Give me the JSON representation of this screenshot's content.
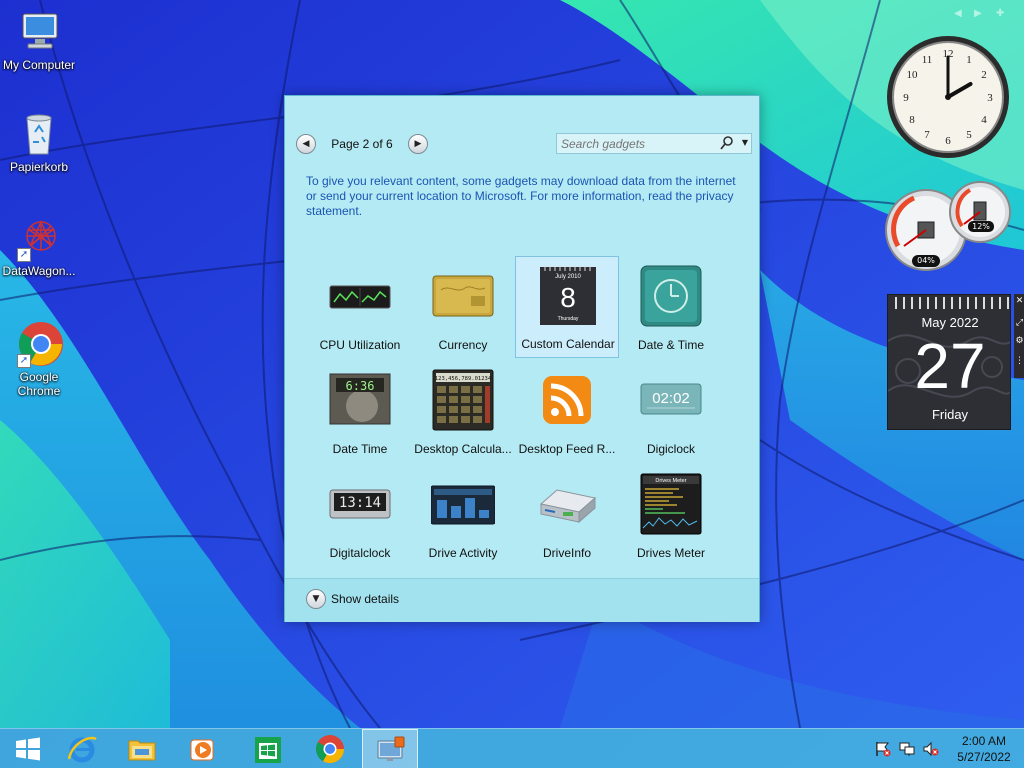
{
  "desktop": {
    "icons": [
      {
        "label": "My Computer"
      },
      {
        "label": "Papierkorb"
      },
      {
        "label": "DataWagon..."
      },
      {
        "label": "Google Chrome"
      }
    ]
  },
  "gallery": {
    "pager": {
      "label": "Page 2 of 6"
    },
    "search": {
      "placeholder": "Search gadgets"
    },
    "privacy_text": "To give you relevant content, some gadgets may download data from the internet or send your current location to Microsoft. For more information, read the privacy statement.",
    "gadgets": [
      {
        "label": "CPU Utilization",
        "selected": false
      },
      {
        "label": "Currency",
        "selected": false
      },
      {
        "label": "Custom Calendar",
        "selected": true
      },
      {
        "label": "Date & Time",
        "selected": false
      },
      {
        "label": "Date Time",
        "selected": false
      },
      {
        "label": "Desktop Calcula...",
        "selected": false
      },
      {
        "label": "Desktop Feed R...",
        "selected": false
      },
      {
        "label": "Digiclock",
        "selected": false
      },
      {
        "label": "Digitalclock",
        "selected": false
      },
      {
        "label": "Drive Activity",
        "selected": false
      },
      {
        "label": "DriveInfo",
        "selected": false
      },
      {
        "label": "Drives Meter",
        "selected": false
      }
    ],
    "thumb_text": {
      "calendar_month": "July 2010",
      "calendar_day": "8",
      "calendar_weekday": "Thursday",
      "calculator_display": "123,456,789.01234",
      "digiclock_time": "02:02",
      "digitalclock_time": "13:14",
      "datetime_time": "6:36",
      "drives_meter_title": "Drives Meter"
    },
    "footer": {
      "label": "Show details"
    }
  },
  "desktop_gadgets": {
    "clock": {
      "hour": 2,
      "minute": 0
    },
    "meters": {
      "cpu": "04%",
      "ram": "12%"
    },
    "calendar": {
      "month": "May 2022",
      "day": "27",
      "weekday": "Friday"
    }
  },
  "taskbar": {
    "items": [
      "start-icon",
      "internet-explorer-icon",
      "file-explorer-icon",
      "media-player-icon",
      "store-icon",
      "chrome-icon",
      "gadgets-icon"
    ],
    "clock": {
      "time": "2:00 AM",
      "date": "5/27/2022"
    }
  },
  "colors": {
    "window_bg": "#b4eaf3",
    "link_text": "#1a55b3",
    "close_button": "#c7392d",
    "taskbar": "#48c0dc"
  }
}
